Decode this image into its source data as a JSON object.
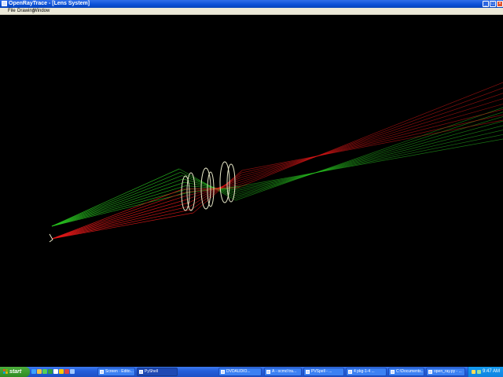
{
  "window": {
    "title": "OpenRayTrace - [Lens System]",
    "buttons": {
      "minimize": "_",
      "maximize": "□",
      "close": "×"
    }
  },
  "menubar": {
    "items": [
      "File",
      "Drawing",
      "Window"
    ]
  },
  "colors": {
    "accent": "#0a4fd6",
    "ray_red": "#e01818",
    "ray_green": "#28c020",
    "lens_outline": "#e8e8c8",
    "viewport_bg": "#000000"
  },
  "taskbar": {
    "start_label": "start",
    "quick_launch": [
      "ie-icon",
      "folder-icon",
      "media-icon",
      "excel-icon",
      "misc-icon",
      "misc-icon",
      "misc-icon",
      "misc-icon"
    ],
    "buttons": [
      {
        "label": "Screen · Edito...",
        "active": false
      },
      {
        "label": "PyShell",
        "active": true
      },
      {
        "label": "DVDAUDIO...",
        "active": false
      },
      {
        "label": "A - ocmd tra...",
        "active": false
      },
      {
        "label": "PVSpell - ...",
        "active": false
      },
      {
        "label": "4 pkg-1-4 ...",
        "active": false
      },
      {
        "label": "C:\\Documents...",
        "active": false
      },
      {
        "label": "open_ray.py - ...",
        "active": false
      }
    ],
    "clock": "9:47 AM"
  }
}
